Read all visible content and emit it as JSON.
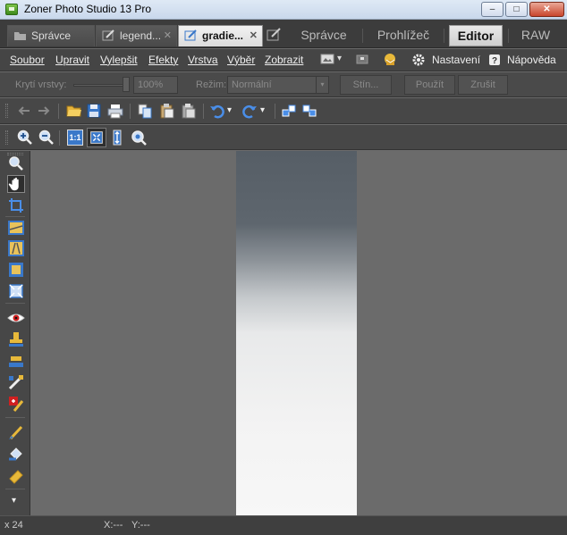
{
  "window": {
    "title": "Zoner Photo Studio 13 Pro",
    "minimize": "–",
    "maximize": "□",
    "close": "✕"
  },
  "tabs": [
    {
      "label": "Správce",
      "close": ""
    },
    {
      "label": "legend...",
      "close": "✕"
    },
    {
      "label": "gradie...",
      "close": "✕"
    }
  ],
  "modules": [
    {
      "label": "Správce"
    },
    {
      "label": "Prohlížeč"
    },
    {
      "label": "Editor"
    },
    {
      "label": "RAW"
    }
  ],
  "menu": {
    "items": [
      "Soubor",
      "Upravit",
      "Vylepšit",
      "Efekty",
      "Vrstva",
      "Výběr",
      "Zobrazit"
    ],
    "settings": "Nastavení",
    "help": "Nápověda",
    "dropdown_arrow": "▾"
  },
  "layerbar": {
    "opacity_label": "Krytí vrstvy:",
    "opacity_value": "100%",
    "mode_label": "Režim:",
    "mode_value": "Normální",
    "shadow_button": "Stín...",
    "apply_button": "Použít",
    "cancel_button": "Zrušit",
    "dropdown_arrow": "▾"
  },
  "toolbar1": {
    "icons": [
      "undo-arrow-icon",
      "redo-arrow-icon",
      "open-folder-icon",
      "save-icon",
      "print-icon",
      "copy-icon",
      "paste-icon",
      "paste-special-icon",
      "undo-icon",
      "redo-icon",
      "rotate-left-icon",
      "rotate-right-icon"
    ],
    "dropdown_arrow": "▾"
  },
  "toolbar2": {
    "icons": [
      "zoom-in-icon",
      "zoom-out-icon",
      "zoom-1to1-icon",
      "fit-to-window-icon",
      "fit-height-icon",
      "zoom-tool-icon"
    ],
    "zoom_1to1_label": "1:1"
  },
  "palette": {
    "tools": [
      "zoom-tool",
      "hand-tool",
      "crop-tool",
      "straighten-tool",
      "perspective-tool",
      "canvas-tool",
      "resize-tool",
      "red-eye-tool",
      "stamp-tool",
      "heal-tool",
      "color-pick-tool",
      "clone-tool",
      "brush-tool",
      "fill-tool",
      "eraser-tool"
    ],
    "more": "▾"
  },
  "status": {
    "zoom": "x 24",
    "x": "X:---",
    "y": "Y:---"
  },
  "colors": {
    "accent": "#3a78c9",
    "background": "#6b6b6b",
    "gradient_top": "#565e66",
    "gradient_bottom": "#f7f7f7"
  }
}
